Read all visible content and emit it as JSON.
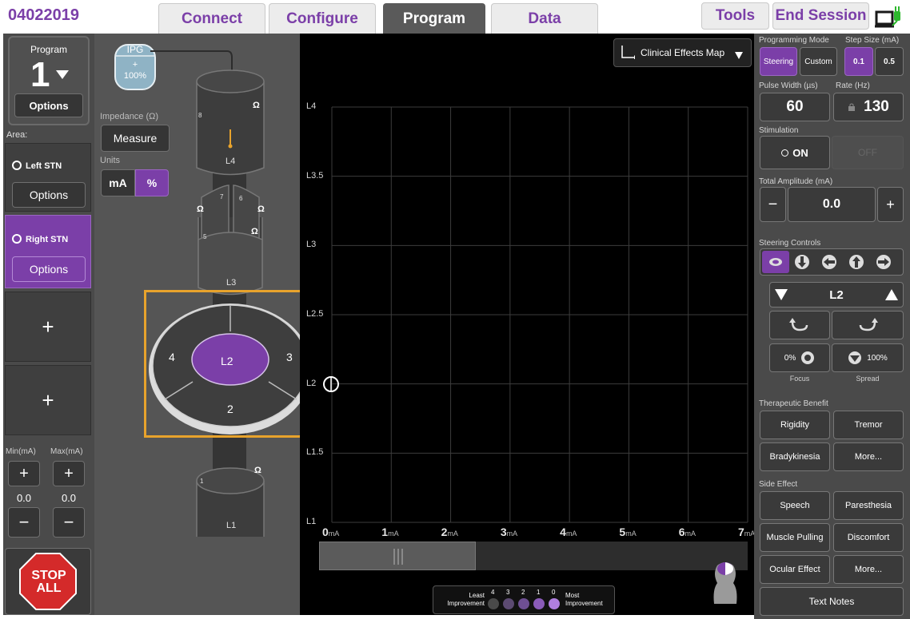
{
  "header": {
    "session_id": "04022019",
    "tabs": [
      {
        "label": "Connect"
      },
      {
        "label": "Configure"
      },
      {
        "label": "Program"
      },
      {
        "label": "Data"
      }
    ],
    "tools_label": "Tools",
    "end_session_label": "End Session"
  },
  "left": {
    "program_label": "Program",
    "program_number": "1",
    "options_label": "Options",
    "area_label": "Area:",
    "areas": [
      {
        "name": "Left STN",
        "options": "Options"
      },
      {
        "name": "Right STN",
        "options": "Options"
      }
    ],
    "add_label": "+",
    "min_label": "Min(mA)",
    "max_label": "Max(mA)",
    "plus": "+",
    "minus": "−",
    "min_value": "0.0",
    "max_value": "0.0",
    "stop_label_1": "STOP",
    "stop_label_2": "ALL"
  },
  "lead": {
    "ipg_label": "IPG",
    "ipg_sign": "+",
    "ipg_percent": "100%",
    "impedance_label": "Impedance (Ω)",
    "measure_label": "Measure",
    "units_label": "Units",
    "unit_ma": "mA",
    "unit_pct": "%",
    "contact_8": "8",
    "level_l4": "L4",
    "contact_7": "7",
    "contact_6": "6",
    "contact_5": "5",
    "level_l3": "L3",
    "contact_1": "1",
    "level_l1": "L1",
    "ohm": "Ω",
    "zoom_center": "L2",
    "zoom_left": "4",
    "zoom_right": "3",
    "zoom_bottom": "2"
  },
  "chart": {
    "dropdown_label": "Clinical Effects Map",
    "y_ticks": [
      "L4",
      "L3.5",
      "L3",
      "L2.5",
      "L2",
      "L1.5",
      "L1"
    ],
    "x_ticks": [
      "0",
      "1",
      "2",
      "3",
      "4",
      "5",
      "6",
      "7"
    ],
    "x_unit": "mA",
    "legend_least_1": "Least",
    "legend_least_2": "Improvement",
    "legend_most_1": "Most",
    "legend_most_2": "Improvement",
    "legend_levels": [
      "4",
      "3",
      "2",
      "1",
      "0"
    ],
    "legend_colors": [
      "#4a4a4a",
      "#5c4a72",
      "#6e4f93",
      "#8a5bb8",
      "#b07fe0"
    ]
  },
  "right": {
    "programming_mode_label": "Programming Mode",
    "step_size_label": "Step Size (mA)",
    "mode_steering": "Steering",
    "mode_custom": "Custom",
    "step_01": "0.1",
    "step_05": "0.5",
    "pulse_width_label": "Pulse Width (µs)",
    "rate_label": "Rate (Hz)",
    "pulse_width_value": "60",
    "rate_value": "130",
    "stimulation_label": "Stimulation",
    "on_label": "ON",
    "off_label": "OFF",
    "total_amplitude_label": "Total Amplitude (mA)",
    "amplitude_value": "0.0",
    "minus": "−",
    "plus": "+",
    "steering_controls_label": "Steering Controls",
    "level_value": "L2",
    "focus_value": "0%",
    "spread_value": "100%",
    "focus_label": "Focus",
    "spread_label": "Spread",
    "therapeutic_benefit_label": "Therapeutic Benefit",
    "benefit_buttons": [
      "Rigidity",
      "Tremor",
      "Bradykinesia",
      "More..."
    ],
    "side_effect_label": "Side Effect",
    "side_effect_buttons": [
      "Speech",
      "Paresthesia",
      "Muscle Pulling",
      "Discomfort",
      "Ocular Effect",
      "More..."
    ],
    "text_notes_label": "Text Notes"
  },
  "colors": {
    "purple": "#7b3fa8",
    "highlight": "#e8a32c"
  }
}
